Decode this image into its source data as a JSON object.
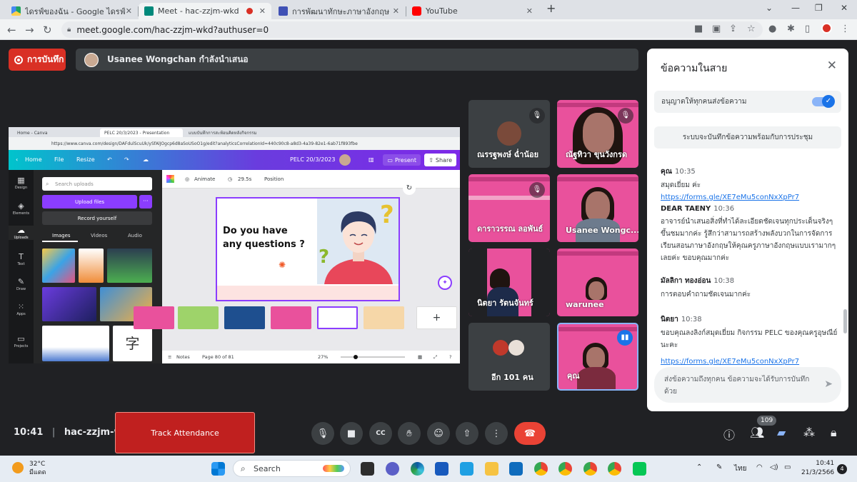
{
  "browser": {
    "tabs": [
      {
        "title": "ไดรฟ์ของฉัน - Google ไดรฟ์"
      },
      {
        "title": "Meet - hac-zzjm-wkd"
      },
      {
        "title": "การพัฒนาทักษะภาษาอังกฤษ English"
      },
      {
        "title": "YouTube"
      }
    ],
    "url": "meet.google.com/hac-zzjm-wkd?authuser=0"
  },
  "meet": {
    "record_label": "การบันทึก",
    "presenter_text": "Usanee Wongchan กำลังนำเสนอ",
    "screen": {
      "tabs": [
        "Home - Canva",
        "PELC 20/3/2023 - Presentation",
        "แบบบันทึกการสะท้อนคิดหลังกิจกรรม"
      ],
      "url": "https://www.canva.com/design/DAFdulScuUk/ySfAlJOgcp6d8aSoUSoO1g/edit?analyticsCorrelationId=440c90c8-a8d3-4a39-82e1-6ab71f893fbe",
      "header": {
        "home": "Home",
        "file": "File",
        "resize": "Resize",
        "doc_title": "PELC 20/3/2023",
        "present": "Present",
        "share": "Share"
      },
      "rail": [
        "Design",
        "Elements",
        "Uploads",
        "Text",
        "Draw",
        "Apps",
        "Projects"
      ],
      "search_placeholder": "Search uploads",
      "upload_btn": "Upload files",
      "record_btn": "Record yourself",
      "media_tabs": [
        "Images",
        "Videos",
        "Audio"
      ],
      "toolbar": {
        "animate": "Animate",
        "duration": "29.5s",
        "position": "Position"
      },
      "slide_text": [
        "Do you have",
        "any questions ?"
      ],
      "footer": {
        "notes": "Notes",
        "page": "Page 80 of 81",
        "zoom": "27%"
      }
    },
    "tiles": [
      {
        "name": "ณรรฐพงษ์ ฉ่ำน้อย"
      },
      {
        "name": "ณัฐทิวา ขุนวังกรด"
      },
      {
        "name": "ดาราวรรณ ลอพันธ์"
      },
      {
        "name": "Usanee Wongc..."
      },
      {
        "name": "นิตยา รัตนจันทร์"
      },
      {
        "name": "warunee"
      },
      {
        "name": "อีก 101 คน"
      },
      {
        "name": "คุณ"
      }
    ],
    "controls": {
      "time": "10:41",
      "meeting_code": "hac-zzjm-wkd",
      "track_attendance": "Track Attendance",
      "participant_count": "109"
    }
  },
  "chat": {
    "title": "ข้อความในสาย",
    "allow_label": "อนุญาตให้ทุกคนส่งข้อความ",
    "keep_label": "ระบบจะบันทึกข้อความพร้อมกับการประชุม",
    "messages": [
      {
        "sender": "คุณ",
        "time": "10:35",
        "text": "สมุดเยี่ยม ค่ะ",
        "link": "https://forms.gle/XE7eMu5conNxXpPr7"
      },
      {
        "sender": "DEAR TAENY",
        "time": "10:36",
        "text": "อาจารย์นำเสนอสิ่งที่ทำได้ละเอียดชัดเจนทุกประเด็นจริงๆ ขึ้นชมมากค่ะ รู้สึกว่าสามารถสร้างพลังบวกในการจัดการเรียนสอนภาษาอังกฤษให้คุณครูภาษาอังกฤษแบบเรามากๆ เลยค่ะ ขอบคุณมากค่ะ"
      },
      {
        "sender": "มัลลิกา ทองอ่อน",
        "time": "10:38",
        "text": "การตอบคำถามชัดเจนมากค่ะ"
      },
      {
        "sender": "นิตยา",
        "time": "10:38",
        "text": "ขอบคุณลงลิงก์สมุดเยี่ยม กิจกรรม PELC ของคุณครูอุษณีย์นะคะ",
        "link": "https://forms.gle/XE7eMu5conNxXpPr7"
      }
    ],
    "compose_placeholder": "ส่งข้อความถึงทุกคน ข้อความจะได้รับการบันทึกด้วย"
  },
  "taskbar": {
    "temp": "32°C",
    "weather": "มีแดด",
    "search": "Search",
    "lang": "ไทย",
    "time": "10:41",
    "date": "21/3/2566",
    "notifications": "4"
  },
  "colors": {
    "record": "#d93025",
    "end_call": "#ea4335",
    "canva_purple": "#8b3dff",
    "tile_pink": "#e9519c",
    "link": "#1a73e8"
  }
}
